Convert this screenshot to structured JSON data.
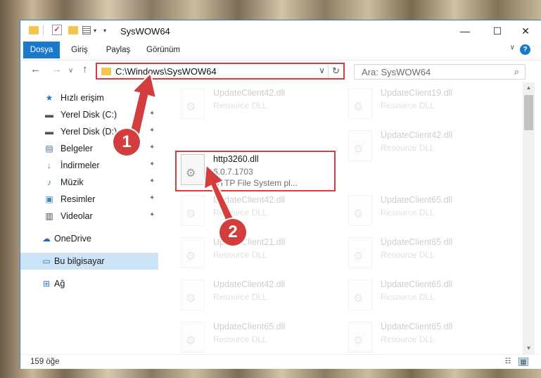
{
  "window": {
    "title": "SysWOW64",
    "minimize_glyph": "—",
    "maximize_glyph": "☐",
    "close_glyph": "✕"
  },
  "quick_access": {
    "check_glyph": "✓",
    "caret_glyph": "▾"
  },
  "ribbon": {
    "tabs": [
      "Dosya",
      "Giriş",
      "Paylaş",
      "Görünüm"
    ],
    "help_glyph": "?",
    "collapse_glyph": "∨"
  },
  "nav": {
    "back_glyph": "←",
    "forward_glyph": "→",
    "recent_glyph": "∨",
    "up_glyph": "↑",
    "address": "C:\\Windows\\SysWOW64",
    "dropdown_glyph": "∨",
    "refresh_glyph": "↻",
    "search_placeholder": "Ara: SysWOW64",
    "search_glyph": "⌕"
  },
  "sidebar": {
    "items": [
      {
        "label": "Hızlı erişim",
        "icon": "star-icon",
        "glyph": "★",
        "color": "#2b78c8",
        "pinned": false
      },
      {
        "label": "Yerel Disk (C:)",
        "icon": "drive-icon",
        "glyph": "▬",
        "color": "#555555",
        "pinned": true
      },
      {
        "label": "Yerel Disk (D:)",
        "icon": "drive-icon",
        "glyph": "▬",
        "color": "#555555",
        "pinned": true
      },
      {
        "label": "Belgeler",
        "icon": "documents-icon",
        "glyph": "▤",
        "color": "#4a6f9c",
        "pinned": true
      },
      {
        "label": "İndirmeler",
        "icon": "download-icon",
        "glyph": "↓",
        "color": "#2b78c8",
        "pinned": true
      },
      {
        "label": "Müzik",
        "icon": "music-icon",
        "glyph": "♪",
        "color": "#2b78c8",
        "pinned": true
      },
      {
        "label": "Resimler",
        "icon": "pictures-icon",
        "glyph": "▣",
        "color": "#3c8ac4",
        "pinned": true
      },
      {
        "label": "Videolar",
        "icon": "video-icon",
        "glyph": "▥",
        "color": "#444444",
        "pinned": true
      },
      {
        "label": "OneDrive",
        "icon": "cloud-icon",
        "glyph": "☁",
        "color": "#1e6fc1",
        "pinned": false
      },
      {
        "label": "Bu bilgisayar",
        "icon": "computer-icon",
        "glyph": "▭",
        "color": "#2b78c8",
        "pinned": false,
        "selected": true
      },
      {
        "label": "Ağ",
        "icon": "network-icon",
        "glyph": "⊞",
        "color": "#2b78c8",
        "pinned": false
      }
    ],
    "pin_glyph": "📌"
  },
  "files": [
    {
      "name": "UpdateClient42.dll",
      "sub": "Resource DLL",
      "faded": true
    },
    {
      "name": "UpdateClient19.dll",
      "sub": "Resource DLL",
      "faded": true
    },
    {
      "name": "http3260.dll",
      "sub": "6.0.7.1703",
      "desc": "HTTP File System pl...",
      "faded": false
    },
    {
      "name": "UpdateClient42.dll",
      "sub": "Resource DLL",
      "faded": true
    },
    {
      "name": "UpdateClient42.dll",
      "sub": "Resource DLL",
      "faded": true
    },
    {
      "name": "UpdateClient65.dll",
      "sub": "Resource DLL",
      "faded": true
    },
    {
      "name": "UpdateClient21.dll",
      "sub": "Resource DLL",
      "faded": true
    },
    {
      "name": "UpdateClient65.dll",
      "sub": "Resource DLL",
      "faded": true
    },
    {
      "name": "UpdateClient42.dll",
      "sub": "Resource DLL",
      "faded": true
    },
    {
      "name": "UpdateClient65.dll",
      "sub": "Resource DLL",
      "faded": true
    },
    {
      "name": "UpdateClient65.dll",
      "sub": "Resource DLL",
      "faded": true
    },
    {
      "name": "UpdateClient65.dll",
      "sub": "Resource DLL",
      "faded": true
    }
  ],
  "status": {
    "count": "159 öğe",
    "details_glyph": "☷",
    "tiles_glyph": "▦"
  },
  "scrollbar": {
    "up_glyph": "▲",
    "down_glyph": "▼"
  },
  "annotations": {
    "step1": "1",
    "step2": "2",
    "accent": "#d33d3d"
  }
}
